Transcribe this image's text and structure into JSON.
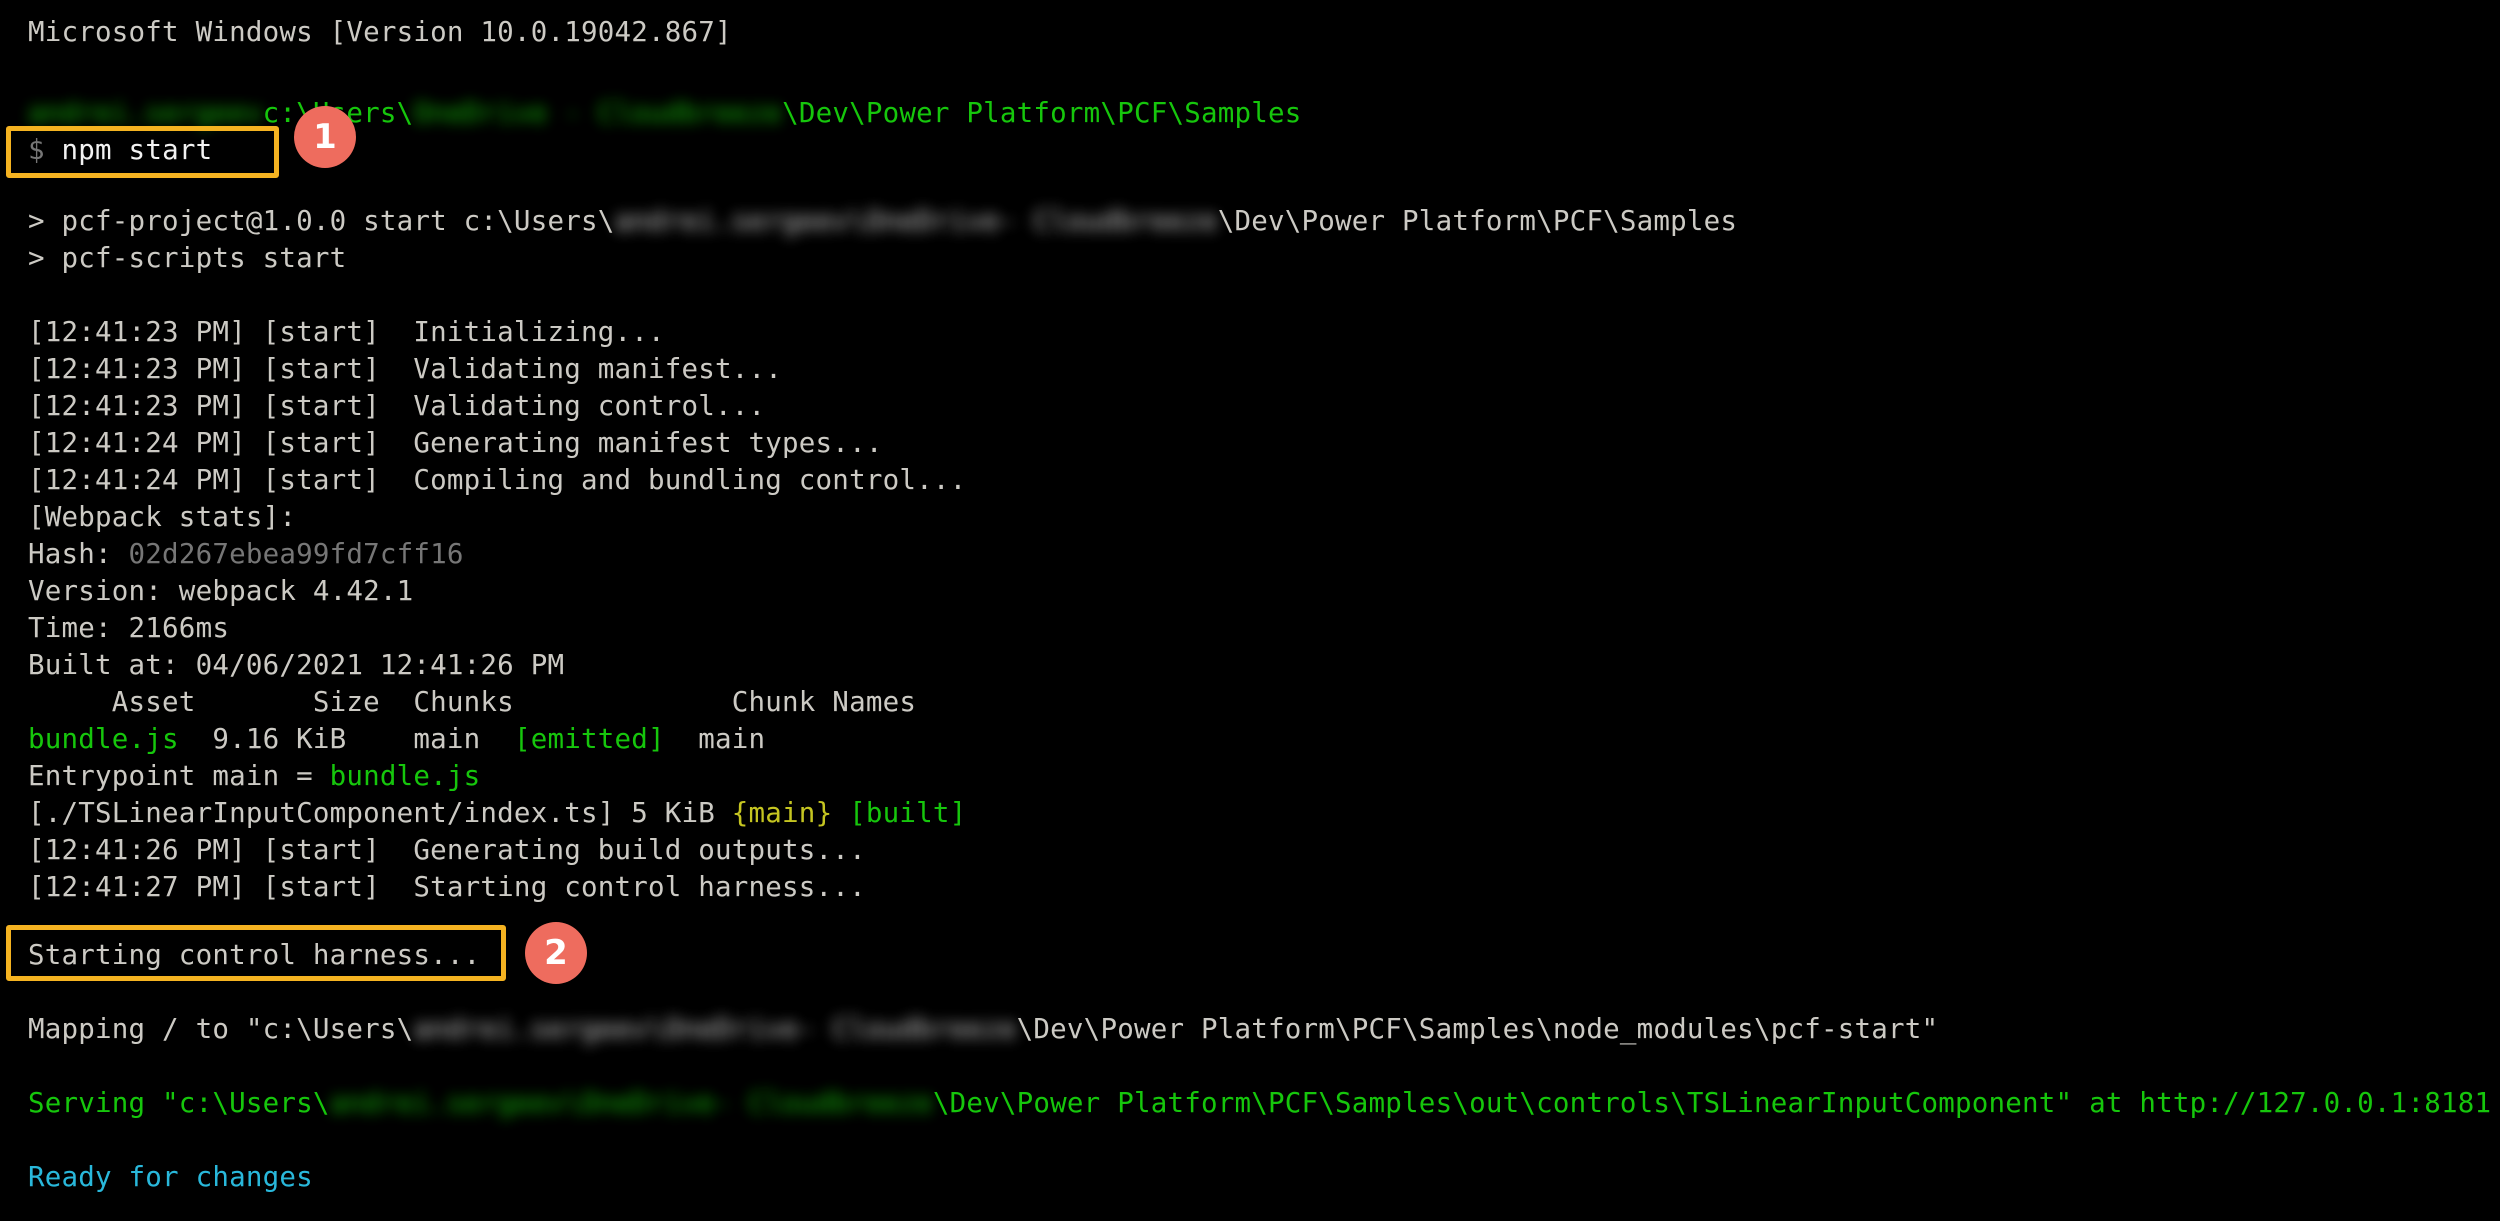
{
  "terminal": {
    "background_color": "#000000",
    "default_text_color": "#cccac4",
    "accent_colors": {
      "highlight_box": "#f5b321",
      "badge": "#ee6c5e",
      "green": "#16c60c",
      "dim_gray": "#767676",
      "yellow": "#c5c521",
      "cyan": "#29b8db"
    },
    "lines": {
      "version_banner": "Microsoft Windows [Version 10.0.19042.867]",
      "prompt_path_redacted": "andrei.sergeev",
      "prompt_path_redacted2": "OneDrive - Cloudbreeze",
      "prompt_path_prefix": "c:\\Users\\",
      "prompt_path_suffix": "\\Dev\\Power Platform\\PCF\\Samples",
      "command_sigil": "$",
      "command": "npm start",
      "npm_run_prefix": "> pcf-project@1.0.0 start c:\\Users\\",
      "npm_run_suffix": "\\Dev\\Power Platform\\PCF\\Samples",
      "npm_run_redacted": "andrei.sergeev\\OneDrive",
      "npm_run_redacted2": "- Cloudbreeze",
      "npm_script": "> pcf-scripts start",
      "log_initializing": "[12:41:23 PM] [start]  Initializing...",
      "log_validating_manifest": "[12:41:23 PM] [start]  Validating manifest...",
      "log_validating_control": "[12:41:23 PM] [start]  Validating control...",
      "log_generating_types": "[12:41:24 PM] [start]  Generating manifest types...",
      "log_compiling": "[12:41:24 PM] [start]  Compiling and bundling control...",
      "webpack_stats_header": "[Webpack stats]:",
      "hash_label": "Hash: ",
      "hash_value": "02d267ebea99fd7cff16",
      "version_line": "Version: webpack 4.42.1",
      "time_line": "Time: 2166ms",
      "built_at_line": "Built at: 04/06/2021 12:41:26 PM",
      "asset_table_header": "     Asset       Size  Chunks             Chunk Names",
      "asset_name": "bundle.js",
      "asset_size_chunks": "  9.16 KiB    main  ",
      "asset_emitted": "[emitted]",
      "asset_chunk_names": "  main",
      "entrypoint_prefix": "Entrypoint main = ",
      "entrypoint_value": "bundle.js",
      "module_path": "[./TSLinearInputComponent/index.ts] 5 KiB ",
      "module_chunk": "{main}",
      "module_built": "[built]",
      "log_generating_outputs": "[12:41:26 PM] [start]  Generating build outputs...",
      "log_starting_harness": "[12:41:27 PM] [start]  Starting control harness...",
      "harness_highlight": "Starting control harness...",
      "mapping_prefix": "Mapping / to \"c:\\Users\\",
      "mapping_redacted": "andrei.sergeev\\OneDrive",
      "mapping_redacted2": "- Cloudbreeze",
      "mapping_suffix": "\\Dev\\Power Platform\\PCF\\Samples\\node_modules\\pcf-start\"",
      "serving_prefix": "Serving \"c:\\Users\\",
      "serving_redacted": "andrei.sergeev\\OneDrive",
      "serving_redacted2": "- Cloudbreeze",
      "serving_suffix": "\\Dev\\Power Platform\\PCF\\Samples\\out\\controls\\TSLinearInputComponent\" at http://127.0.0.1:8181",
      "ready_line": "Ready for changes"
    },
    "annotations": {
      "step_one": "1",
      "step_two": "2"
    }
  }
}
